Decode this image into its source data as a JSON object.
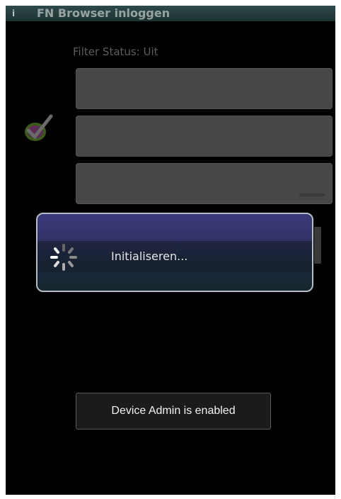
{
  "app": {
    "title": "FN Browser inloggen",
    "title_icon": "info-icon"
  },
  "filter": {
    "status_text": "Filter Status: Uit"
  },
  "form": {
    "fields": [
      {
        "name": "username-field",
        "hint": ""
      },
      {
        "name": "password-field",
        "hint": ""
      },
      {
        "name": "login-field",
        "hint": ""
      }
    ],
    "logo_icon": "checkmark-badge-icon"
  },
  "progress_dialog": {
    "message": "Initialiseren...",
    "spinner_icon": "spinner-icon",
    "colors": {
      "top": "#3a3a7a",
      "bottom": "#15272e",
      "border": "#b7bcc8"
    }
  },
  "toast": {
    "message": "Device Admin is enabled"
  }
}
